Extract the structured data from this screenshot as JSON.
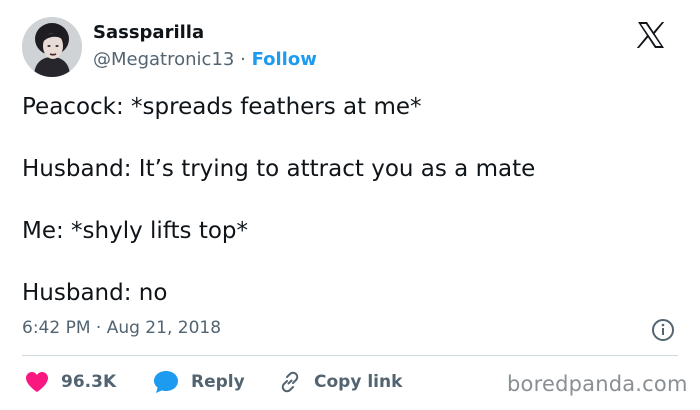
{
  "author": {
    "name": "Sassparilla",
    "handle": "@Megatronic13",
    "separator": "·",
    "follow_label": "Follow"
  },
  "tweet": {
    "lines": [
      "Peacock: *spreads feathers at me*",
      "Husband: It’s trying to attract you as a mate",
      "Me: *shyly lifts top*",
      "Husband: no"
    ],
    "timestamp": "6:42 PM · Aug 21, 2018"
  },
  "actions": {
    "likes": "96.3K",
    "reply_label": "Reply",
    "copy_link_label": "Copy link"
  },
  "watermark": "boredpanda.com",
  "colors": {
    "like": "#f91880",
    "reply": "#1d9bf0",
    "follow": "#1d9bf0",
    "muted": "#536471"
  },
  "icons": [
    "avatar-photo",
    "x-logo-icon",
    "info-icon",
    "heart-icon",
    "reply-bubble-icon",
    "link-icon"
  ]
}
